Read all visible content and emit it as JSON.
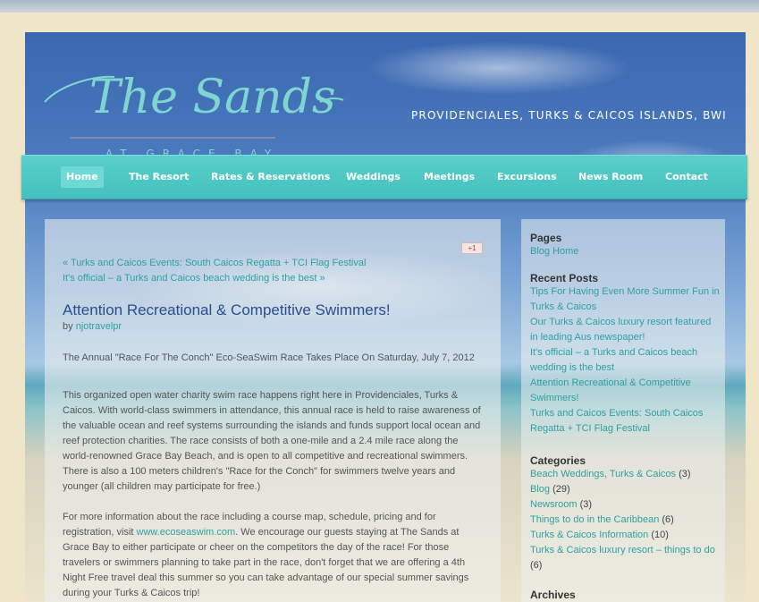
{
  "header": {
    "logo_script": "The Sands",
    "logo_sub": "AT GRACE BAY",
    "tagline": "PROVIDENCIALES, TURKS & CAICOS ISLANDS, BWI"
  },
  "nav": {
    "items": [
      {
        "label": "Home"
      },
      {
        "label": "The Resort"
      },
      {
        "label": "Rates & Reservations"
      },
      {
        "label": "Weddings"
      },
      {
        "label": "Meetings"
      },
      {
        "label": "Excursions"
      },
      {
        "label": "News Room"
      },
      {
        "label": "Contact"
      }
    ]
  },
  "post": {
    "gplus_label": "+1",
    "prev_link": "« Turks and Caicos Events: South Caicos Regatta + TCI Flag Festival",
    "next_link": "It's official – a Turks and Caicos beach wedding is the best »",
    "title": "Attention Recreational & Competitive Swimmers!",
    "by_label": "by",
    "author": "njotravelpr",
    "intro": "The Annual \"Race For The Conch\" Eco-SeaSwim Race Takes Place On Saturday, July 7, 2012",
    "para1": "This organized open water charity swim race happens right here in Providenciales, Turks & Caicos. With world-class swimmers in attendance, this annual race is held to raise awareness of the valuable ocean and reef systems surrounding the islands and funds support local ocean and reef protection charities. The race consists of both a one-mile and a 2.4 mile race along the world-renowned Grace Bay Beach, and is open to all competitive and recreational swimmers. There is also a 100 meters children's \"Race for the Conch\" for swimmers twelve years and younger (all children may participate for free.)",
    "para2_before": "For more information about the race including a course map, schedule, pricing and for registration, visit ",
    "para2_link": "www.ecoseaswim.com",
    "para2_after": ". We encourage our guests staying at The Sands at Grace Bay to either participate or cheer on the competitors the day of the race! For those travelers or swimmers planning to take part in the race, don't forget that we are offering a 4th Night Free travel deal this summer so you can take advantage of our special summer savings during your Turks & Caicos trip!"
  },
  "sidebar": {
    "pages_heading": "Pages",
    "pages": [
      {
        "label": "Blog Home"
      }
    ],
    "recent_heading": "Recent Posts",
    "recent": [
      {
        "label": "Tips For Having Even More Summer Fun in Turks & Caicos"
      },
      {
        "label": "Our Turks & Caicos luxury resort featured in leading Aus newspaper!"
      },
      {
        "label": "It's official – a Turks and Caicos beach wedding is the best"
      },
      {
        "label": "Attention Recreational & Competitive Swimmers!"
      },
      {
        "label": "Turks and Caicos Events: South Caicos Regatta + TCI Flag Festival"
      }
    ],
    "categories_heading": "Categories",
    "categories": [
      {
        "label": "Beach Weddings, Turks & Caicos",
        "count": "(3)"
      },
      {
        "label": "Blog",
        "count": "(29)"
      },
      {
        "label": "Newsroom",
        "count": "(3)"
      },
      {
        "label": "Things to do in the Caribbean",
        "count": "(6)"
      },
      {
        "label": "Turks & Caicos Information",
        "count": "(10)"
      },
      {
        "label": "Turks & Caicos luxury resort – things to do",
        "count": "(6)"
      }
    ],
    "archives_heading": "Archives"
  },
  "colors": {
    "nav_bg": "#4fc8c4",
    "link": "#2f9fa2",
    "title": "#2a4d8f",
    "logo": "#7fd6d0"
  }
}
